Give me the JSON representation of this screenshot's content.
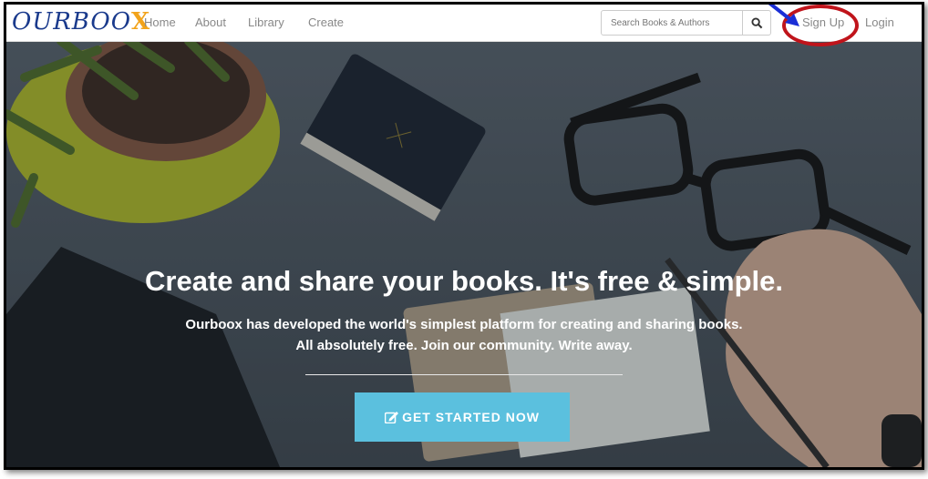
{
  "header": {
    "logo": {
      "text": "OURBOO",
      "x_letter": "X"
    },
    "nav": [
      "Home",
      "About",
      "Library",
      "Create"
    ],
    "search_placeholder": "Search Books & Authors",
    "signup_label": "Sign Up",
    "login_label": "Login"
  },
  "hero": {
    "headline": "Create and share your books. It's free & simple.",
    "subline_1": "Ourboox has developed the world's simplest platform for creating and sharing books.",
    "subline_2": "All absolutely free. Join our community. Write away.",
    "cta_label": "GET STARTED NOW"
  },
  "colors": {
    "cta": "#5bc0de",
    "annotation_circle": "#c0141b",
    "annotation_arrow": "#1a2ed6",
    "logo_blue": "#1a3a8c",
    "logo_x": "#f2a31a"
  }
}
